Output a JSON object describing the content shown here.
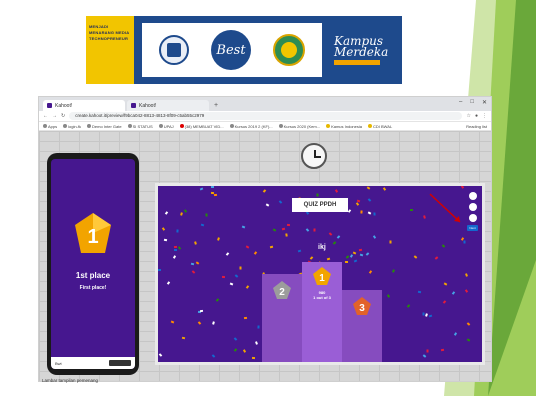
{
  "banner": {
    "tagline": "MENJADI MENARANG MEDIA TECHNOPRENEUR",
    "best_logo_text": "Best",
    "kampus_line1": "Kampus",
    "kampus_line2": "Merdeka"
  },
  "browser": {
    "tabs": [
      {
        "label": "Kahoot!"
      },
      {
        "label": "Kahoot!"
      }
    ],
    "url": "create.kahoot.it/preview/f9bca042-8813-4813-8f09-c5ab55c2979",
    "bookmarks": [
      "Apps",
      "login-fk",
      "Demo Inter Gate",
      "SI STATUS",
      "UPAJ",
      "(38) MEMBUAT VID...",
      "Kursus 2019 2 (KF)...",
      "Kursus 2020 (Kem...",
      "Kamus Indonesia",
      "CDI BWAL"
    ],
    "reading_list": "Reading list"
  },
  "phone": {
    "place_number": "1",
    "place_title": "1st place",
    "place_subtitle": "First place!",
    "bottom_left": "Bwt"
  },
  "board": {
    "quiz_title": "QUIZ PPDH",
    "winner_name": "ikj",
    "first": {
      "rank": "1",
      "score": "980",
      "detail": "1 out of 3"
    },
    "second": {
      "rank": "2"
    },
    "third": {
      "rank": "3"
    },
    "next_label": "Next"
  },
  "caption": "Lambar tampilan pemenang",
  "colors": {
    "kahoot_purple": "#46178f",
    "podium": "#864cbf",
    "gold": "#f2a400",
    "green_accent": "#8cc63f",
    "banner_blue": "#1e4a8c"
  }
}
